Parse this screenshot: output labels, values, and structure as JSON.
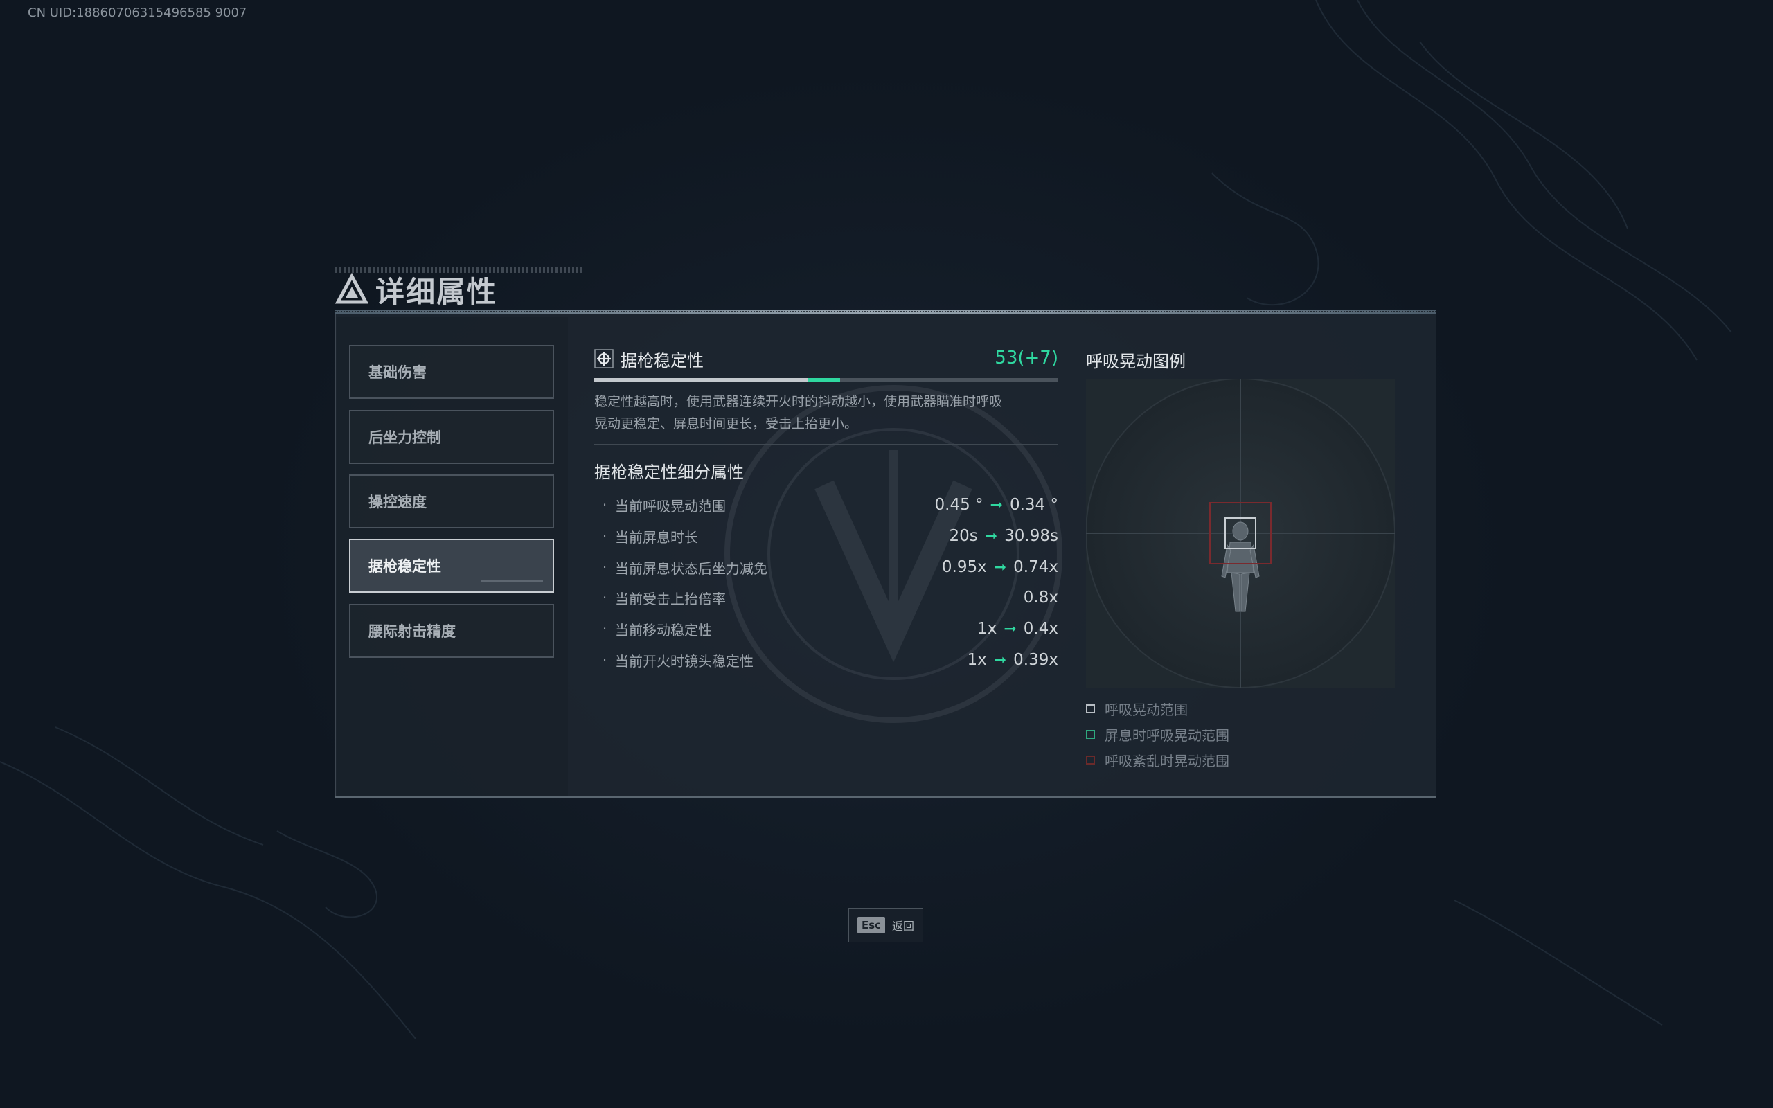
{
  "uid": "CN UID:18860706315496585 9007",
  "page_title": "详细属性",
  "tabs": [
    {
      "label": "基础伤害",
      "active": false
    },
    {
      "label": "后坐力控制",
      "active": false
    },
    {
      "label": "操控速度",
      "active": false
    },
    {
      "label": "据枪稳定性",
      "active": true
    },
    {
      "label": "腰际射击精度",
      "active": false
    }
  ],
  "attribute": {
    "name": "据枪稳定性",
    "value": "53(+7)",
    "base_value": 53,
    "bonus_value": 7,
    "description_line1": "稳定性越高时，使用武器连续开火时的抖动越小，使用武器瞄准时呼吸",
    "description_line2": "晃动更稳定、屏息时间更长，受击上抬更小。",
    "accent_color": "#2fd8a0"
  },
  "sub_section_title": "据枪稳定性细分属性",
  "stats": [
    {
      "label": "当前呼吸晃动范围",
      "from": "0.45 °",
      "arrow": "➞",
      "to": "0.34 °"
    },
    {
      "label": "当前屏息时长",
      "from": "20s",
      "arrow": "➞",
      "to": "30.98s"
    },
    {
      "label": "当前屏息状态后坐力减免",
      "from": "0.95x",
      "arrow": "➞",
      "to": "0.74x"
    },
    {
      "label": "当前受击上抬倍率",
      "from": "",
      "arrow": "",
      "to": "0.8x"
    },
    {
      "label": "当前移动稳定性",
      "from": "1x",
      "arrow": "➞",
      "to": "0.4x"
    },
    {
      "label": "当前开火时镜头稳定性",
      "from": "1x",
      "arrow": "➞",
      "to": "0.39x"
    }
  ],
  "legend": {
    "title": "呼吸晃动图例",
    "items": [
      {
        "label": "呼吸晃动范围",
        "color": "#b8bec4"
      },
      {
        "label": "屏息时呼吸晃动范围",
        "color": "#2fa87e"
      },
      {
        "label": "呼吸紊乱时晃动范围",
        "color": "#6b2a2a"
      }
    ]
  },
  "footer": {
    "key": "Esc",
    "label": "返回"
  }
}
